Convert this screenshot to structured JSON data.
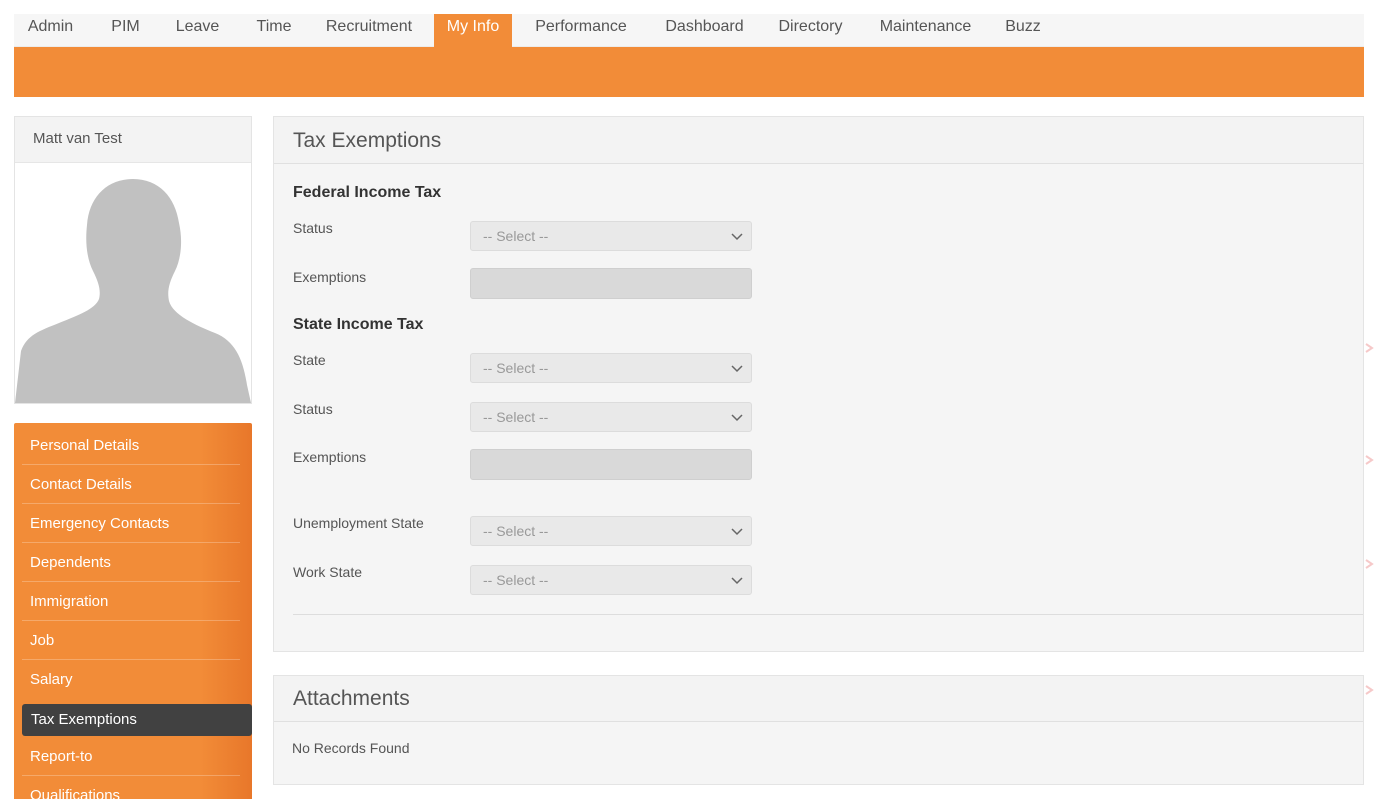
{
  "nav": {
    "items": [
      {
        "label": "Admin"
      },
      {
        "label": "PIM"
      },
      {
        "label": "Leave"
      },
      {
        "label": "Time"
      },
      {
        "label": "Recruitment"
      },
      {
        "label": "My Info",
        "active": true
      },
      {
        "label": "Performance"
      },
      {
        "label": "Dashboard"
      },
      {
        "label": "Directory"
      },
      {
        "label": "Maintenance"
      },
      {
        "label": "Buzz"
      }
    ]
  },
  "profile": {
    "name": "Matt van Test",
    "avatar_icon": "person-silhouette-icon"
  },
  "side_menu": {
    "items": [
      {
        "label": "Personal Details"
      },
      {
        "label": "Contact Details"
      },
      {
        "label": "Emergency Contacts"
      },
      {
        "label": "Dependents"
      },
      {
        "label": "Immigration"
      },
      {
        "label": "Job"
      },
      {
        "label": "Salary"
      },
      {
        "label": "Tax Exemptions",
        "active": true
      },
      {
        "label": "Report-to"
      },
      {
        "label": "Qualifications"
      }
    ]
  },
  "tax_exemptions": {
    "title": "Tax Exemptions",
    "federal": {
      "title": "Federal Income Tax",
      "status_label": "Status",
      "status_value": "-- Select --",
      "exemptions_label": "Exemptions",
      "exemptions_value": ""
    },
    "state": {
      "title": "State Income Tax",
      "state_label": "State",
      "state_value": "-- Select --",
      "status_label": "Status",
      "status_value": "-- Select --",
      "exemptions_label": "Exemptions",
      "exemptions_value": ""
    },
    "unemployment_state_label": "Unemployment State",
    "unemployment_state_value": "-- Select --",
    "work_state_label": "Work State",
    "work_state_value": "-- Select --"
  },
  "attachments": {
    "title": "Attachments",
    "empty_text": "No Records Found"
  },
  "colors": {
    "accent": "#f28c38",
    "active_menu": "#414141"
  }
}
